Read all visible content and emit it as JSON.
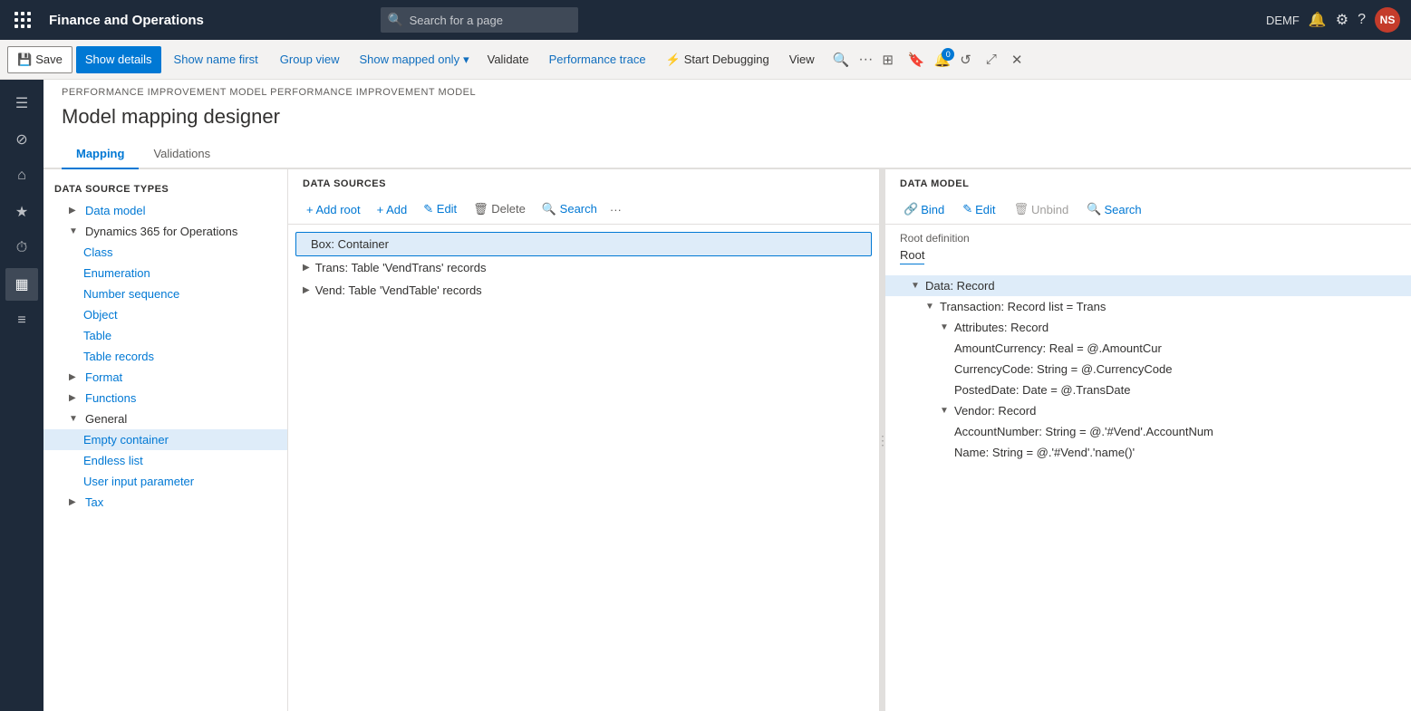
{
  "topbar": {
    "grid_icon": "apps-icon",
    "title": "Finance and Operations",
    "search_placeholder": "Search for a page",
    "user_env": "DEMF",
    "user_initials": "NS",
    "icons": [
      "bell-icon",
      "settings-icon",
      "help-icon"
    ]
  },
  "toolbar": {
    "save_label": "Save",
    "show_details_label": "Show details",
    "show_name_first_label": "Show name first",
    "group_view_label": "Group view",
    "show_mapped_only_label": "Show mapped only",
    "validate_label": "Validate",
    "performance_trace_label": "Performance trace",
    "start_debugging_label": "Start Debugging",
    "view_label": "View"
  },
  "breadcrumb": "PERFORMANCE IMPROVEMENT MODEL  PERFORMANCE IMPROVEMENT MODEL",
  "page_title": "Model mapping designer",
  "tabs": [
    {
      "label": "Mapping",
      "active": true
    },
    {
      "label": "Validations",
      "active": false
    }
  ],
  "data_source_types": {
    "header": "DATA SOURCE TYPES",
    "items": [
      {
        "label": "Data model",
        "indent": 1,
        "expanded": false,
        "arrow": "▶"
      },
      {
        "label": "Dynamics 365 for Operations",
        "indent": 1,
        "expanded": true,
        "arrow": "▼"
      },
      {
        "label": "Class",
        "indent": 2
      },
      {
        "label": "Enumeration",
        "indent": 2
      },
      {
        "label": "Number sequence",
        "indent": 2
      },
      {
        "label": "Object",
        "indent": 2
      },
      {
        "label": "Table",
        "indent": 2
      },
      {
        "label": "Table records",
        "indent": 2
      },
      {
        "label": "Format",
        "indent": 1,
        "expanded": false,
        "arrow": "▶"
      },
      {
        "label": "Functions",
        "indent": 1,
        "expanded": false,
        "arrow": "▶"
      },
      {
        "label": "General",
        "indent": 1,
        "expanded": true,
        "arrow": "▼"
      },
      {
        "label": "Empty container",
        "indent": 2,
        "selected": true
      },
      {
        "label": "Endless list",
        "indent": 2
      },
      {
        "label": "User input parameter",
        "indent": 2
      },
      {
        "label": "Tax",
        "indent": 1,
        "expanded": false,
        "arrow": "▶"
      }
    ]
  },
  "data_sources": {
    "header": "DATA SOURCES",
    "toolbar": {
      "add_root_label": "+ Add root",
      "add_label": "+ Add",
      "edit_label": "✎ Edit",
      "delete_label": "🗑 Delete",
      "search_label": "🔍 Search",
      "more_label": "···"
    },
    "items": [
      {
        "label": "Box: Container",
        "selected": true,
        "arrow": ""
      },
      {
        "label": "Trans: Table 'VendTrans' records",
        "arrow": "▶"
      },
      {
        "label": "Vend: Table 'VendTable' records",
        "arrow": "▶"
      }
    ]
  },
  "data_model": {
    "header": "DATA MODEL",
    "toolbar": {
      "bind_label": "Bind",
      "edit_label": "Edit",
      "unbind_label": "Unbind",
      "search_label": "Search"
    },
    "root_definition_label": "Root definition",
    "root_value": "Root",
    "tree": [
      {
        "label": "Data: Record",
        "indent": 1,
        "arrow": "▼",
        "selected": true
      },
      {
        "label": "Transaction: Record list = Trans",
        "indent": 2,
        "arrow": "▼"
      },
      {
        "label": "Attributes: Record",
        "indent": 3,
        "arrow": "▼"
      },
      {
        "label": "AmountCurrency: Real = @.AmountCur",
        "indent": 4
      },
      {
        "label": "CurrencyCode: String = @.CurrencyCode",
        "indent": 4
      },
      {
        "label": "PostedDate: Date = @.TransDate",
        "indent": 4
      },
      {
        "label": "Vendor: Record",
        "indent": 3,
        "arrow": "▼"
      },
      {
        "label": "AccountNumber: String = @.'#Vend'.AccountNum",
        "indent": 4
      },
      {
        "label": "Name: String = @.'#Vend'.'name()'",
        "indent": 4
      }
    ]
  },
  "sidebar_icons": [
    {
      "name": "hamburger-icon",
      "symbol": "☰"
    },
    {
      "name": "home-icon",
      "symbol": "⌂"
    },
    {
      "name": "star-icon",
      "symbol": "★"
    },
    {
      "name": "recent-icon",
      "symbol": "⏱"
    },
    {
      "name": "calendar-icon",
      "symbol": "📅"
    },
    {
      "name": "list-icon",
      "symbol": "☰"
    }
  ]
}
